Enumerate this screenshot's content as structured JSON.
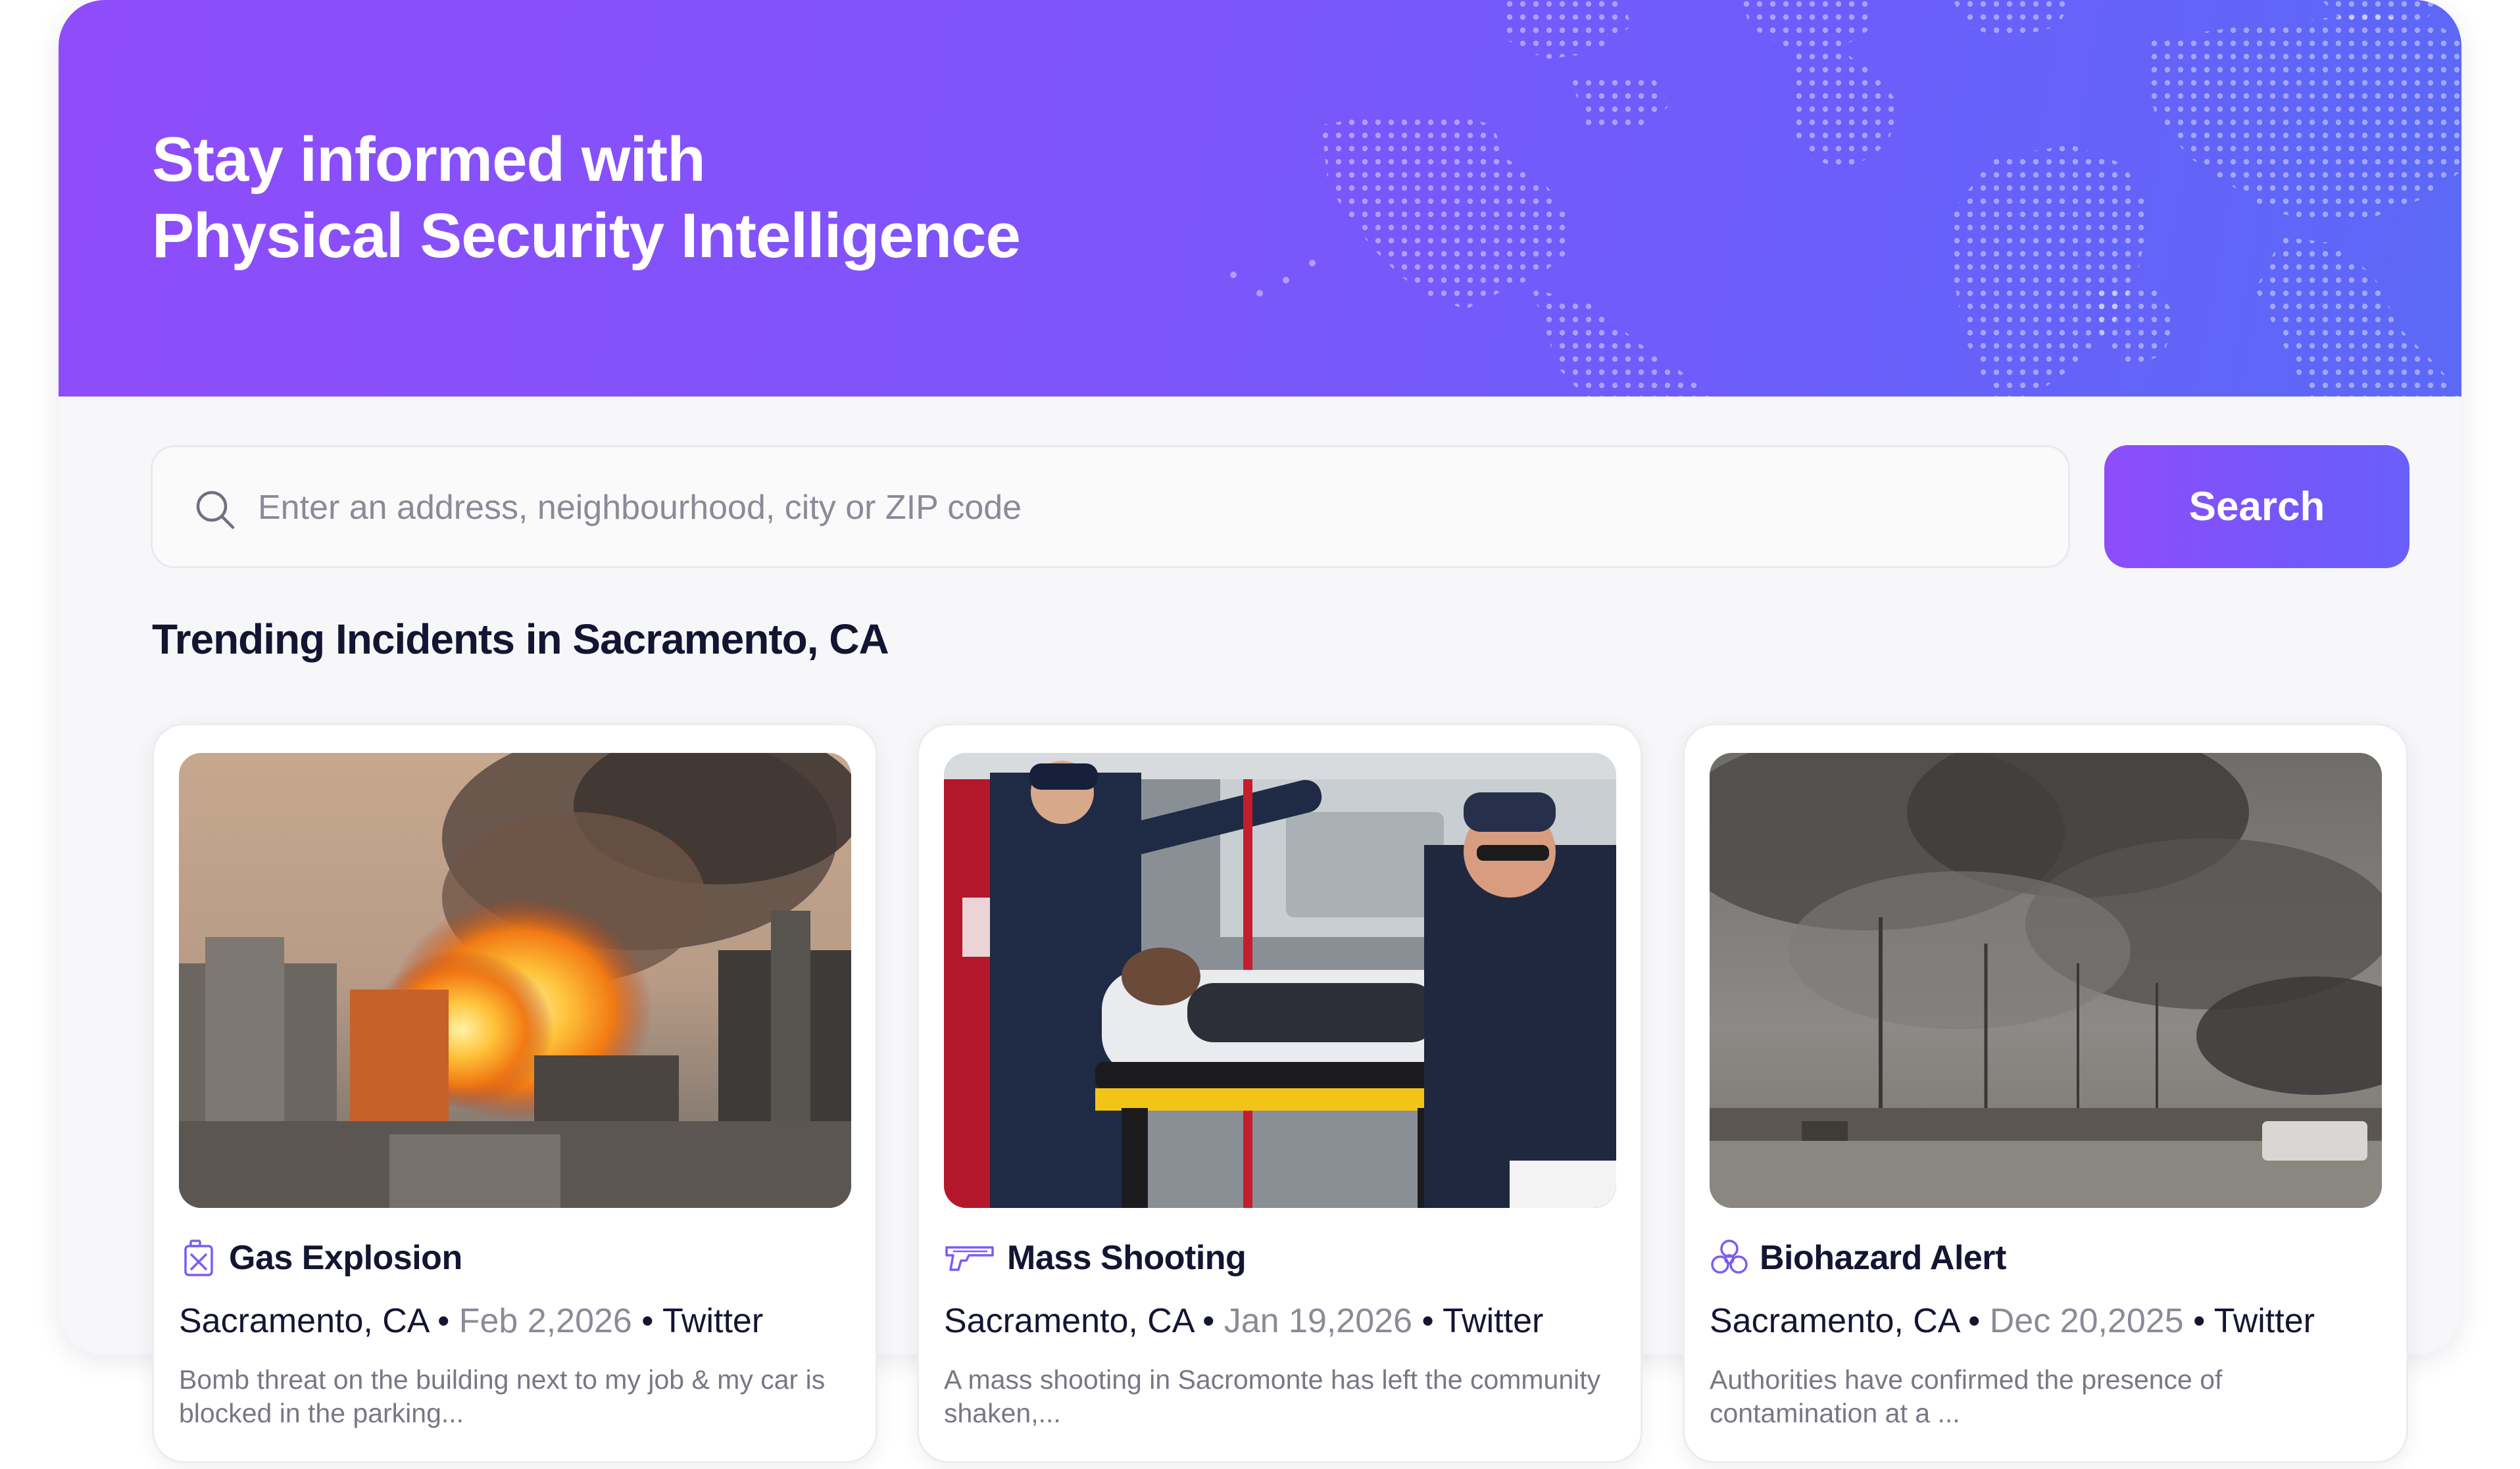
{
  "hero": {
    "title_line1": "Stay informed with",
    "title_line2": "Physical Security Intelligence"
  },
  "search": {
    "placeholder": "Enter an address, neighbourhood, city or ZIP code",
    "value": "",
    "button_label": "Search",
    "icon": "search-icon"
  },
  "section": {
    "title": "Trending Incidents in Sacramento, CA"
  },
  "colors": {
    "brand_start": "#8f4cfb",
    "brand_end": "#5b69f6",
    "icon_purple": "#7b5cf5",
    "text_dark": "#141533",
    "text_muted": "#8a8b98"
  },
  "cards": [
    {
      "type": "Gas Explosion",
      "icon": "gas-canister-icon",
      "location": "Sacramento, CA",
      "date": "Feb 2,2026",
      "source": "Twitter",
      "description": "Bomb threat on the building next to my job & my car is blocked in the parking...",
      "image": "explosion-photo"
    },
    {
      "type": "Mass Shooting",
      "icon": "gun-icon",
      "location": "Sacramento, CA",
      "date": "Jan 19,2026",
      "source": "Twitter",
      "description": "A mass shooting in Sacromonte has left the community shaken,...",
      "image": "paramedics-stretcher-photo"
    },
    {
      "type": "Biohazard Alert",
      "icon": "biohazard-icon",
      "location": "Sacramento, CA",
      "date": "Dec 20,2025",
      "source": "Twitter",
      "description": "Authorities have confirmed the presence of contamination at a ...",
      "image": "smoke-over-road-photo"
    }
  ]
}
